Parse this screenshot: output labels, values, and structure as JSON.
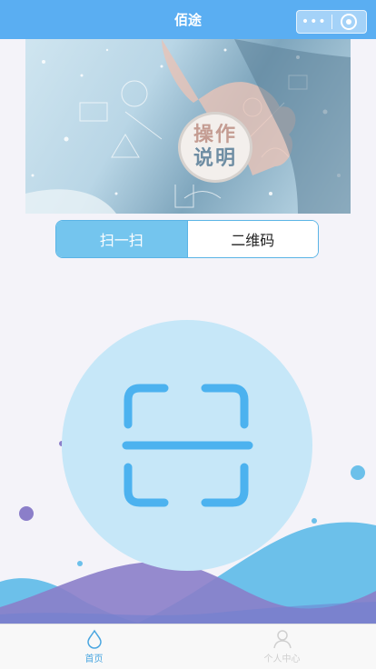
{
  "header": {
    "title": "佰途",
    "more_icon": "more-dots-icon",
    "close_icon": "close-target-icon",
    "color": "#5aaef2"
  },
  "banner": {
    "line1": "操作",
    "line2": "说明",
    "image": "hand-touching-bubble-illustration"
  },
  "tabs": [
    {
      "label": "扫一扫",
      "active": true
    },
    {
      "label": "二维码",
      "active": false
    }
  ],
  "scan": {
    "icon": "scan-frame-icon",
    "circle_color": "#c6e7f8",
    "icon_color": "#4cb2ef"
  },
  "bottom_nav": [
    {
      "label": "首页",
      "icon": "droplet-icon",
      "active": true
    },
    {
      "label": "个人中心",
      "icon": "person-icon",
      "active": false
    }
  ],
  "colors": {
    "accent": "#4aa6e0",
    "wave_blue": "#6cc0ea",
    "wave_purple": "#8b7ec9"
  }
}
